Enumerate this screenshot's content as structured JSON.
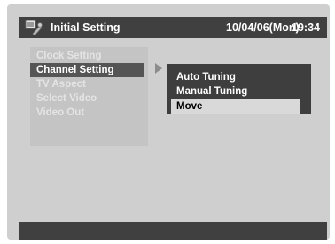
{
  "titlebar": {
    "icon": "setup-tools-icon",
    "title": "Initial Setting",
    "date": "10/04/06(Mon)",
    "time": "19:34"
  },
  "main_menu": {
    "items": [
      {
        "label": "Clock Setting"
      },
      {
        "label": "Channel Setting",
        "active": true
      },
      {
        "label": "TV Aspect"
      },
      {
        "label": "Select Video"
      },
      {
        "label": "Video Out"
      }
    ]
  },
  "sub_menu": {
    "items": [
      {
        "label": "Auto Tuning"
      },
      {
        "label": "Manual Tuning"
      },
      {
        "label": "Move",
        "selected": true
      }
    ]
  },
  "colors": {
    "screen_bg": "#cfcfcf",
    "bar_bg": "#404040",
    "highlight": "#555555",
    "submenu_bg": "#3e3e3e",
    "selected_bg": "#d9d9d9"
  }
}
